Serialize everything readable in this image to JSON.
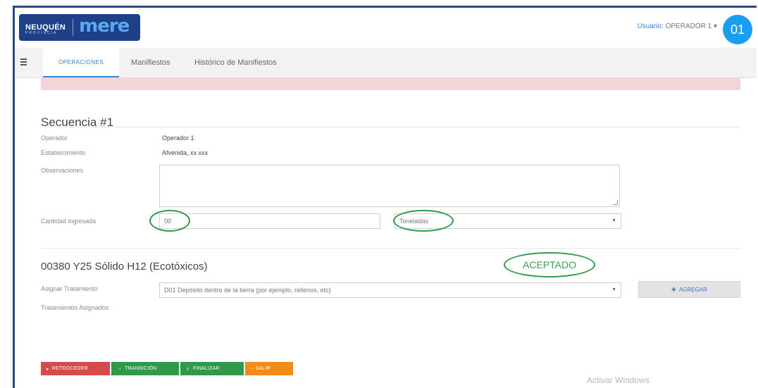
{
  "header": {
    "logo_text": "NEUQUÉN",
    "logo_sub": "PROVINCIA",
    "logo_brand": "mere",
    "user_label": "Usuario:",
    "user_name": "OPERADOR 1",
    "user_caret": "▾",
    "avatar_text": "01"
  },
  "nav": {
    "tabs": [
      {
        "label": "OPERACIONES"
      },
      {
        "label": "Manifiestos"
      },
      {
        "label": "Histórico de Manifiestos"
      }
    ]
  },
  "sequence": {
    "title": "Secuencia #1",
    "operador_label": "Operador",
    "operador_value": "Operador 1",
    "establecimiento_label": "Establecimiento",
    "establecimiento_value": "Afvenida, xx xxx",
    "observaciones_label": "Observaciones",
    "observaciones_value": "",
    "cantidad_label": "Cantidad ingresada",
    "cantidad_value": "00",
    "unidad_value": "Toneladas"
  },
  "waste": {
    "title": "00380 Y25 Sólido H12 (Ecotóxicos)",
    "status": "ACEPTADO",
    "asignar_label": "Asignar Tratamiento",
    "tratamiento_value": "D01 Depósito dentro de la tierra (por ejemplo, rellenos, etc)",
    "agregar_label": "AGREGAR",
    "asignados_label": "Tratamientos Asignados"
  },
  "actions": [
    {
      "label": "RETROCEDER",
      "icon": "arrow-icon"
    },
    {
      "label": "TRANSICIÓN",
      "icon": "arrow-icon"
    },
    {
      "label": "FINALIZAR",
      "icon": "check-icon"
    },
    {
      "label": "SALIR",
      "icon": "back-icon"
    }
  ],
  "watermark": "Activar Windows",
  "colors": {
    "brand_blue": "#1f3f86",
    "accent_blue": "#2d85d8",
    "accept_green": "#2f9a4a",
    "danger_red": "#d64a4a",
    "warning_orange": "#f08c1a",
    "alert_pink": "#f3d5d9"
  }
}
